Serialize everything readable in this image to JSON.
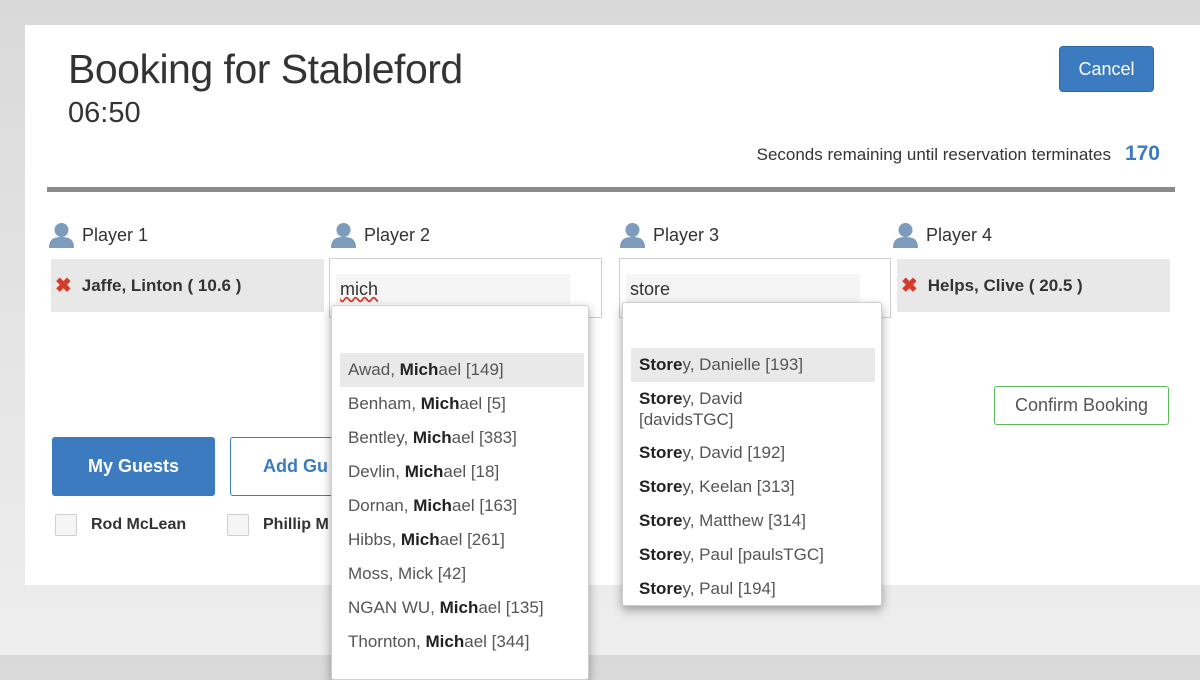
{
  "header": {
    "title": "Booking for Stableford",
    "time": "06:50",
    "cancel_label": "Cancel",
    "timer_label": "Seconds remaining until reservation terminates",
    "timer_value": "170"
  },
  "players": [
    {
      "label": "Player 1",
      "name": "Jaffe, Linton ( 10.6 )"
    },
    {
      "label": "Player 2",
      "query": "mich"
    },
    {
      "label": "Player 3",
      "query": "store"
    },
    {
      "label": "Player 4",
      "name": "Helps, Clive ( 20.5 )"
    }
  ],
  "player2_results": [
    {
      "pre": "Awad, ",
      "match": "Mich",
      "post": "ael [149]"
    },
    {
      "pre": "Benham, ",
      "match": "Mich",
      "post": "ael [5]"
    },
    {
      "pre": "Bentley, ",
      "match": "Mich",
      "post": "ael [383]"
    },
    {
      "pre": "Devlin, ",
      "match": "Mich",
      "post": "ael [18]"
    },
    {
      "pre": "Dornan, ",
      "match": "Mich",
      "post": "ael [163]"
    },
    {
      "pre": "Hibbs, ",
      "match": "Mich",
      "post": "ael [261]"
    },
    {
      "pre": "Moss, Mick [42]",
      "match": "",
      "post": ""
    },
    {
      "pre": "NGAN WU, ",
      "match": "Mich",
      "post": "ael [135]"
    },
    {
      "pre": "Thornton, ",
      "match": "Mich",
      "post": "ael [344]"
    }
  ],
  "player3_results": [
    {
      "pre": "",
      "match": "Store",
      "post": "y, Danielle [193]"
    },
    {
      "pre": "",
      "match": "Store",
      "post": "y, David [davidsTGC]"
    },
    {
      "pre": "",
      "match": "Store",
      "post": "y, David [192]"
    },
    {
      "pre": "",
      "match": "Store",
      "post": "y, Keelan [313]"
    },
    {
      "pre": "",
      "match": "Store",
      "post": "y, Matthew [314]"
    },
    {
      "pre": "",
      "match": "Store",
      "post": "y, Paul [paulsTGC]"
    },
    {
      "pre": "",
      "match": "Store",
      "post": "y, Paul [194]"
    }
  ],
  "actions": {
    "confirm_label": "Confirm Booking",
    "my_guests_label": "My Guests",
    "add_guest_label": "Add Gu"
  },
  "guests": [
    "Rod McLean",
    "Phillip M"
  ],
  "colors": {
    "primary": "#3c7bbf",
    "remove": "#d63a2b",
    "confirm_border": "#5cb85c",
    "divider": "#8a8a8a"
  }
}
